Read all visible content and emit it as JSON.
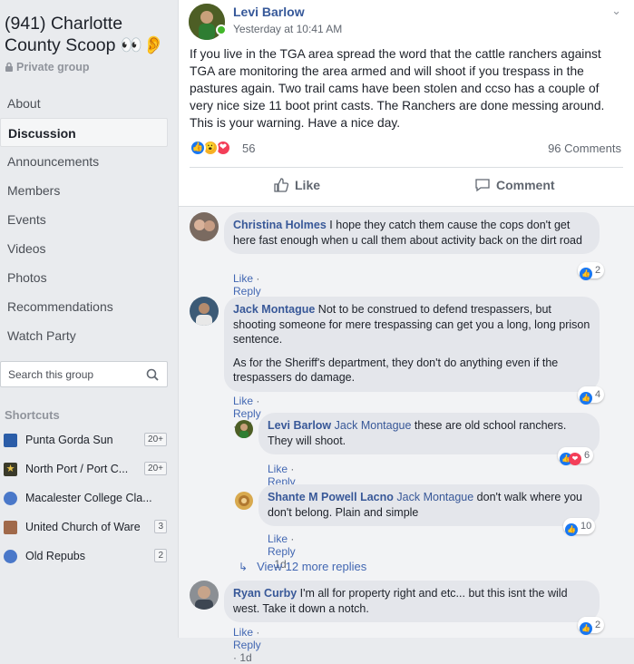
{
  "group": {
    "title": "(941) Charlotte County Scoop 👀👂",
    "privacy": "Private group"
  },
  "nav": [
    {
      "label": "About",
      "active": false
    },
    {
      "label": "Discussion",
      "active": true
    },
    {
      "label": "Announcements",
      "active": false
    },
    {
      "label": "Members",
      "active": false
    },
    {
      "label": "Events",
      "active": false
    },
    {
      "label": "Videos",
      "active": false
    },
    {
      "label": "Photos",
      "active": false
    },
    {
      "label": "Recommendations",
      "active": false
    },
    {
      "label": "Watch Party",
      "active": false
    }
  ],
  "search": {
    "placeholder": "Search this group"
  },
  "shortcuts": {
    "heading": "Shortcuts",
    "items": [
      {
        "label": "Punta Gorda Sun",
        "badge": "20+"
      },
      {
        "label": "North Port / Port C...",
        "badge": "20+"
      },
      {
        "label": "Macalester College Cla...",
        "badge": ""
      },
      {
        "label": "United Church of Ware",
        "badge": "3"
      },
      {
        "label": "Old Repubs",
        "badge": "2"
      }
    ]
  },
  "post": {
    "author": "Levi Barlow",
    "time": "Yesterday at 10:41 AM",
    "text": "If you live in the TGA area spread the word that the cattle ranchers against TGA are monitoring the area armed and will shoot if you trespass in the pastures again. Two trail cams have been stolen and ccso has a couple of very nice size 11 boot print casts. The Ranchers are done messing around. This is your warning. Have a nice day.",
    "reaction_count": "56",
    "comment_count": "96 Comments",
    "like_label": "Like",
    "comment_label": "Comment"
  },
  "comments": [
    {
      "author": "Christina Holmes",
      "tag": "",
      "paragraphs": [
        "I hope they catch them cause the cops don't get here fast enough when u call them about activity back on the dirt road"
      ],
      "reactions": "2"
    },
    {
      "author": "Jack Montague",
      "tag": "",
      "paragraphs": [
        "Not to be construed to defend trespassers, but shooting someone for mere trespassing can get you a long, long prison sentence.",
        "As for the Sheriff's department, they don't do anything even if the trespassers do damage."
      ],
      "reactions": "4"
    },
    {
      "author": "Levi Barlow",
      "tag": "Jack Montague",
      "paragraphs": [
        "these are old school ranchers. They will shoot."
      ],
      "reactions": "6"
    },
    {
      "author": "Shante M Powell Lacno",
      "tag": "Jack Montague",
      "paragraphs": [
        "don't walk where you don't belong. Plain and simple"
      ],
      "reactions": "10"
    },
    {
      "author": "Ryan Curby",
      "tag": "",
      "paragraphs": [
        "I'm all for property right and etc... but this isnt the wild west. Take it down a notch."
      ],
      "reactions": "2"
    }
  ],
  "comment_actions": {
    "like": "Like",
    "reply": "Reply",
    "sep": "·",
    "age": "1d"
  },
  "view_more": "View 12 more replies",
  "colors": {
    "link": "#365899",
    "like_blue": "#1877f2",
    "love_red": "#f33e58",
    "wow_yellow": "#f7b125"
  }
}
